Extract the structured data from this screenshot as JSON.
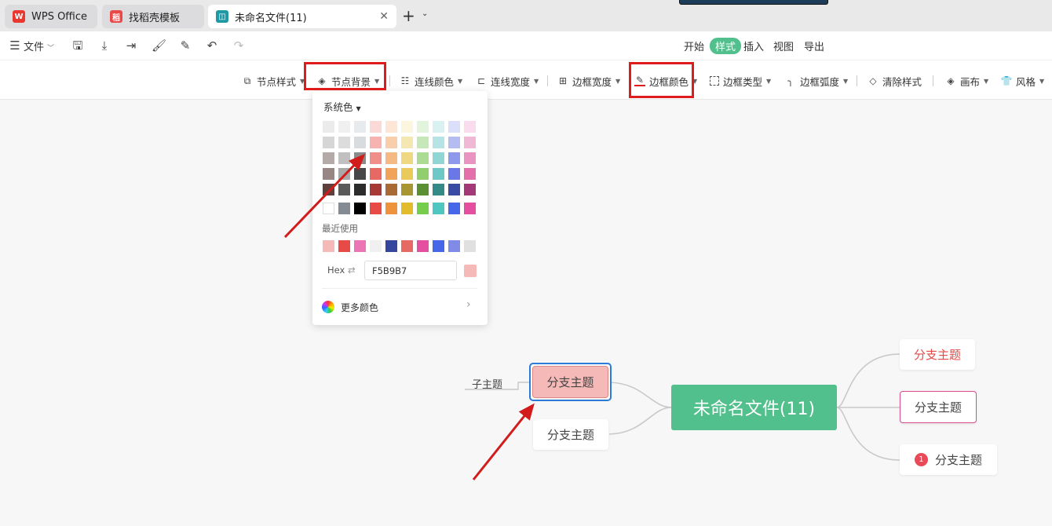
{
  "tabs": [
    {
      "label": "WPS Office",
      "icon": "wps-logo-icon"
    },
    {
      "label": "找稻壳模板",
      "icon": "docer-icon"
    },
    {
      "label": "未命名文件(11)",
      "icon": "mindmap-icon"
    }
  ],
  "menubar": {
    "file_label": "文件",
    "ribbon_tabs": [
      "开始",
      "样式",
      "插入",
      "视图",
      "导出"
    ],
    "active_tab": "样式"
  },
  "toolbar": {
    "node_style": "节点样式",
    "node_background": "节点背景",
    "line_color": "连线颜色",
    "line_width": "连线宽度",
    "border_width": "边框宽度",
    "border_color": "边框颜色",
    "border_type": "边框类型",
    "border_radius": "边框弧度",
    "clear_style": "清除样式",
    "canvas": "画布",
    "theme": "风格"
  },
  "color_panel": {
    "system_colors_label": "系统色",
    "recent_label": "最近使用",
    "hex_label": "Hex",
    "hex_value": "F5B9B7",
    "more_colors_label": "更多颜色",
    "grid": [
      [
        "#ebebeb",
        "#f0f0f0",
        "#e8ebee",
        "#fbd9d7",
        "#fde6d5",
        "#fdf6df",
        "#e2f4dc",
        "#daf1f1",
        "#dcdff9",
        "#f9dced"
      ],
      [
        "#d6d6d6",
        "#dcdcdc",
        "#d9dcdf",
        "#f6b3b0",
        "#f9cfab",
        "#f5e7b2",
        "#c6e8b9",
        "#b6e3e3",
        "#b5bcf2",
        "#f1b8d6"
      ],
      [
        "#b4aaa7",
        "#c0c0c0",
        "#8a8a8a",
        "#f08e8a",
        "#f5b983",
        "#efd882",
        "#acdc93",
        "#91d6d4",
        "#8f99ec",
        "#ea94c1"
      ],
      [
        "#978684",
        "#a8a8a8",
        "#474747",
        "#e76964",
        "#f2a35a",
        "#e9ca5b",
        "#91cf6e",
        "#6dc8c6",
        "#6a77e6",
        "#e36fab"
      ],
      [
        "#5e3f3c",
        "#5a5a5a",
        "#2b2b2b",
        "#a63836",
        "#a86b33",
        "#a89633",
        "#5a8f33",
        "#338a86",
        "#3a4ba3",
        "#a33a77"
      ],
      [
        "#ffffff",
        "#858b93",
        "#000000",
        "#e84a48",
        "#ee933c",
        "#e2bc2a",
        "#75cd4c",
        "#4ec7c1",
        "#4567e8",
        "#e54f9f"
      ]
    ],
    "recent": [
      "#f5b9b7",
      "#e84a48",
      "#ec75b5",
      "#f0f0f0",
      "#34479c",
      "#e76964",
      "#e54f9f",
      "#4567e8",
      "#7f8be6",
      "#e0e0e0"
    ],
    "preview_color": "#f5b9b7"
  },
  "mindmap": {
    "root": "未命名文件(11)",
    "left_selected": "分支主题",
    "left_sub": "子主题",
    "left_second": "分支主题",
    "right_1": "分支主题",
    "right_2": "分支主题",
    "right_3": "分支主题",
    "right_3_badge": "1"
  },
  "colors": {
    "accent": "#52c08c",
    "highlight_red": "#e01b1b",
    "selected_fill": "#f5b9b7",
    "selection_blue": "#2d7bd8"
  }
}
